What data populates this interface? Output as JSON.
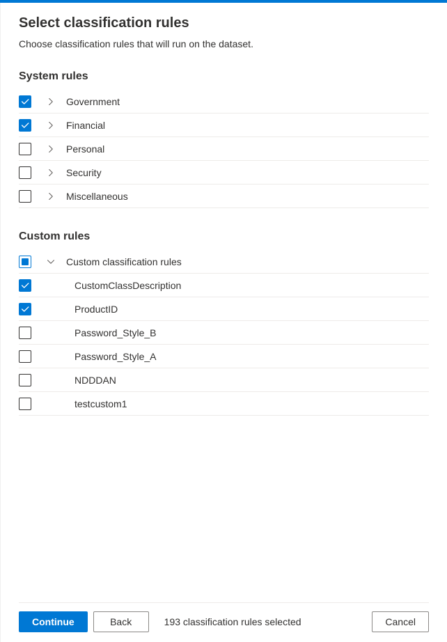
{
  "header": {
    "title": "Select classification rules",
    "subtitle": "Choose classification rules that will run on the dataset."
  },
  "system_rules": {
    "heading": "System rules",
    "items": [
      {
        "label": "Government",
        "checked": true,
        "expanded": false
      },
      {
        "label": "Financial",
        "checked": true,
        "expanded": false
      },
      {
        "label": "Personal",
        "checked": false,
        "expanded": false
      },
      {
        "label": "Security",
        "checked": false,
        "expanded": false
      },
      {
        "label": "Miscellaneous",
        "checked": false,
        "expanded": false
      }
    ]
  },
  "custom_rules": {
    "heading": "Custom rules",
    "group": {
      "label": "Custom classification rules",
      "state": "indeterminate",
      "expanded": true
    },
    "items": [
      {
        "label": "CustomClassDescription",
        "checked": true
      },
      {
        "label": "ProductID",
        "checked": true
      },
      {
        "label": "Password_Style_B",
        "checked": false
      },
      {
        "label": "Password_Style_A",
        "checked": false
      },
      {
        "label": "NDDDAN",
        "checked": false
      },
      {
        "label": "testcustom1",
        "checked": false
      }
    ]
  },
  "footer": {
    "continue_label": "Continue",
    "back_label": "Back",
    "cancel_label": "Cancel",
    "status": "193 classification rules selected"
  }
}
